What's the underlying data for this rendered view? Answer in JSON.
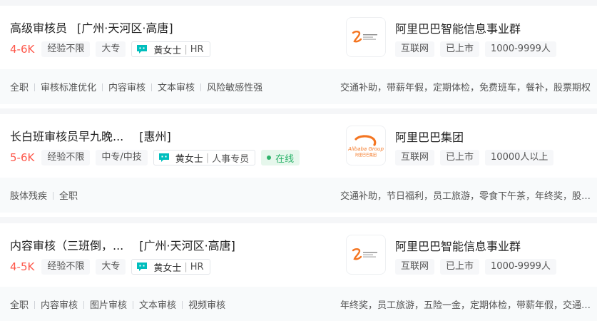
{
  "jobs": [
    {
      "title": "高级审核员",
      "location": "[广州·天河区·高唐]",
      "salary": "4-6K",
      "experience": "经验不限",
      "education": "大专",
      "recruiter_name": "黄女士",
      "recruiter_role": "HR",
      "online": "",
      "company": "阿里巴巴智能信息事业群",
      "industry": "互联网",
      "stage": "已上市",
      "size": "1000-9999人",
      "skills": [
        "全职",
        "审核标准优化",
        "内容审核",
        "文本审核",
        "风险敏感性强"
      ],
      "welfare": "交通补助，带薪年假，定期体检，免费班车，餐补，股票期权"
    },
    {
      "title": "长白班审核员早九晚...",
      "location": "[惠州]",
      "salary": "5-6K",
      "experience": "经验不限",
      "education": "中专/中技",
      "recruiter_name": "黄女士",
      "recruiter_role": "人事专员",
      "online": "在线",
      "company": "阿里巴巴集团",
      "industry": "互联网",
      "stage": "已上市",
      "size": "10000人以上",
      "skills": [
        "肢体残疾",
        "全职"
      ],
      "welfare": "交通补助，节日福利，员工旅游，零食下午茶，年终奖，股票期权"
    },
    {
      "title": "内容审核（三班倒，...",
      "location": "[广州·天河区·高唐]",
      "salary": "4-5K",
      "experience": "经验不限",
      "education": "大专",
      "recruiter_name": "黄女士",
      "recruiter_role": "HR",
      "online": "",
      "company": "阿里巴巴智能信息事业群",
      "industry": "互联网",
      "stage": "已上市",
      "size": "1000-9999人",
      "skills": [
        "全职",
        "内容审核",
        "图片审核",
        "文本审核",
        "视频审核"
      ],
      "welfare": "年终奖，员工旅游，五险一金，定期体检，带薪年假，交通补助"
    }
  ],
  "logos": {
    "alibaba_group_text": "Alibaba Group",
    "alibaba_group_cn": "阿里巴巴集团",
    "colors": {
      "orange": "#f47521",
      "salary": "#fe574a",
      "online_green": "#2eb36b",
      "chat_teal": "#00bebd"
    }
  }
}
